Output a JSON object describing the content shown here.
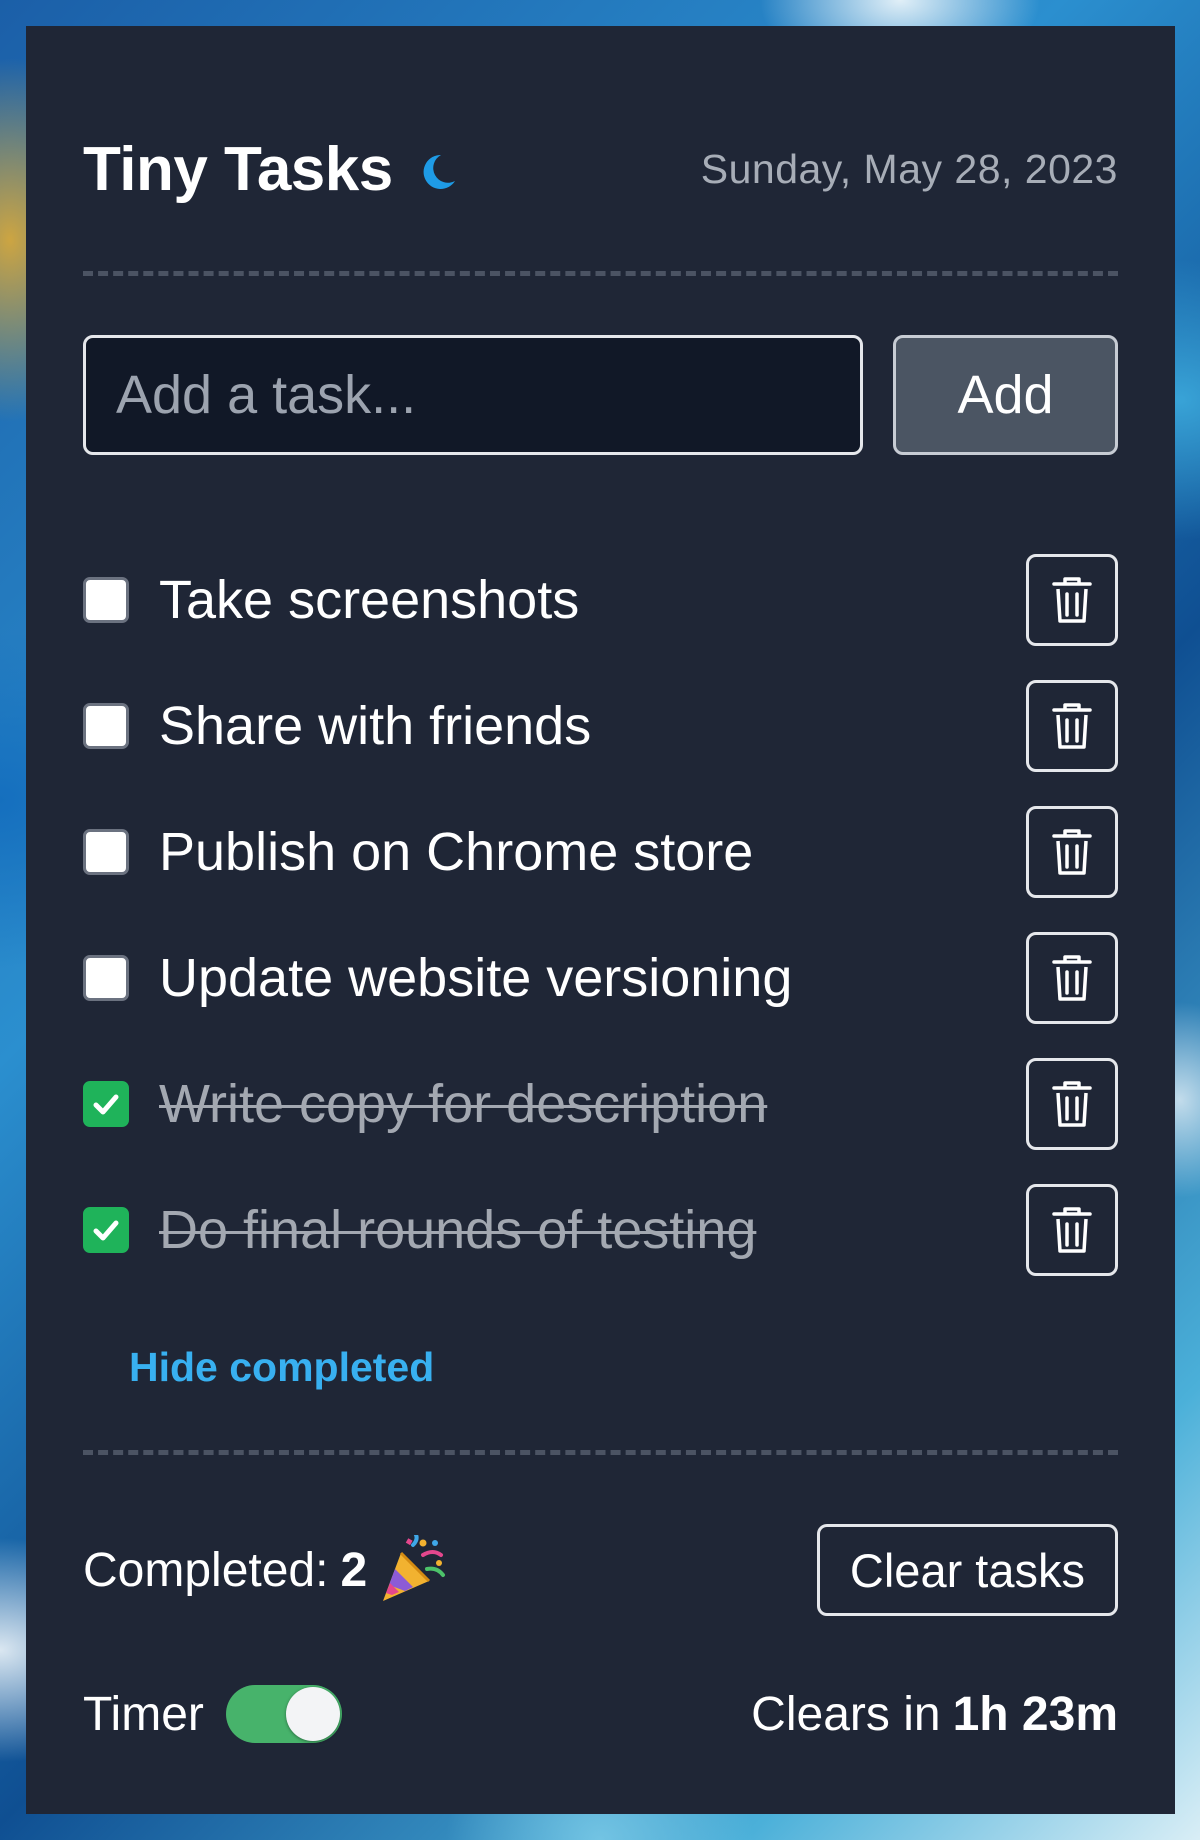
{
  "app": {
    "title": "Tiny Tasks",
    "date": "Sunday, May 28, 2023"
  },
  "add_task": {
    "placeholder": "Add a task...",
    "value": "",
    "button_label": "Add"
  },
  "tasks": [
    {
      "label": "Take screenshots",
      "completed": false
    },
    {
      "label": "Share with friends",
      "completed": false
    },
    {
      "label": "Publish on Chrome store",
      "completed": false
    },
    {
      "label": "Update website versioning",
      "completed": false
    },
    {
      "label": "Write copy for description",
      "completed": true
    },
    {
      "label": "Do final rounds of testing",
      "completed": true
    }
  ],
  "hide_completed_label": "Hide completed",
  "footer": {
    "completed_label": "Completed:",
    "completed_count": "2",
    "clear_button_label": "Clear tasks",
    "timer_label": "Timer",
    "timer_enabled": true,
    "clears_in_label": "Clears in",
    "clears_in_value": "1h 23m"
  },
  "colors": {
    "panel_bg": "#1f2636",
    "accent_link": "#38b0f0",
    "checked_green": "#1fb35a",
    "toggle_green": "#47b36b",
    "moon_blue": "#1e9be6"
  },
  "icons": {
    "theme": "moon-icon",
    "delete": "trash-icon",
    "celebrate": "party-popper-icon",
    "check": "check-icon"
  }
}
